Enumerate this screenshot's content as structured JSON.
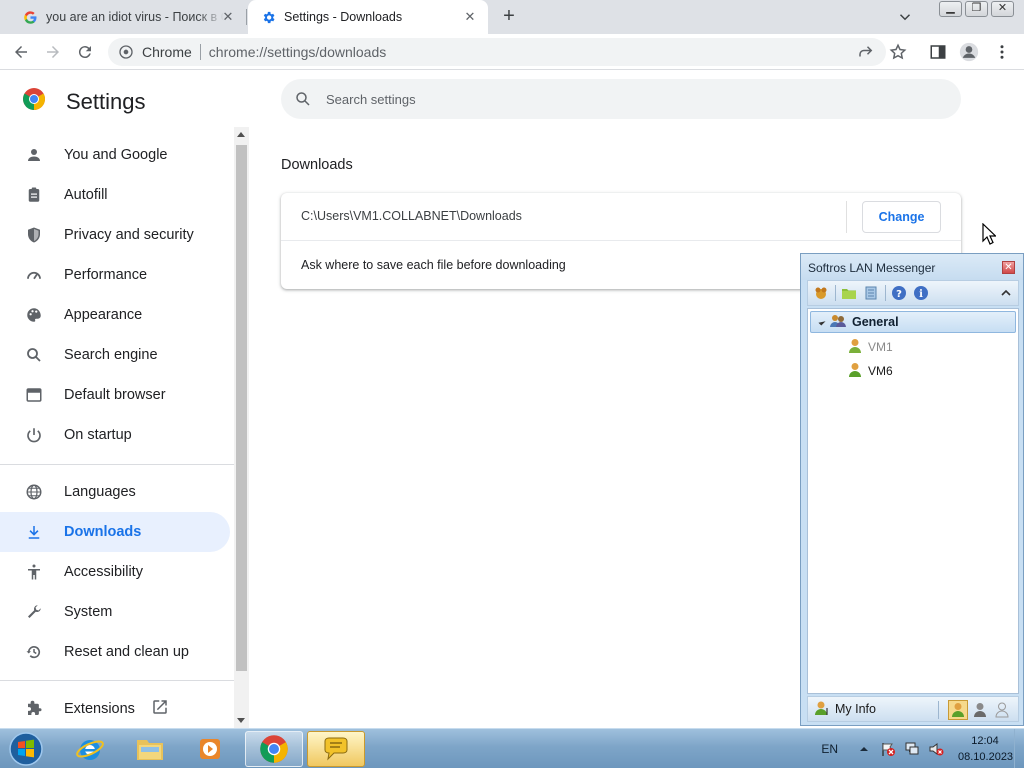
{
  "browser": {
    "tabs": [
      {
        "title": "you are an idiot virus - Поиск в Google",
        "icon": "google-g-icon"
      },
      {
        "title": "Settings - Downloads",
        "icon": "gear-icon"
      }
    ],
    "omnibox": {
      "chip": "Chrome",
      "url": "chrome://settings/downloads"
    }
  },
  "settings": {
    "brand": "Settings",
    "search_placeholder": "Search settings",
    "nav": [
      {
        "label": "You and Google",
        "icon": "person-icon"
      },
      {
        "label": "Autofill",
        "icon": "clipboard-icon"
      },
      {
        "label": "Privacy and security",
        "icon": "shield-icon"
      },
      {
        "label": "Performance",
        "icon": "speedometer-icon"
      },
      {
        "label": "Appearance",
        "icon": "palette-icon"
      },
      {
        "label": "Search engine",
        "icon": "search-icon"
      },
      {
        "label": "Default browser",
        "icon": "browser-window-icon"
      },
      {
        "label": "On startup",
        "icon": "power-icon"
      },
      {
        "label": "Languages",
        "icon": "globe-icon"
      },
      {
        "label": "Downloads",
        "icon": "download-icon",
        "active": true
      },
      {
        "label": "Accessibility",
        "icon": "accessibility-icon"
      },
      {
        "label": "System",
        "icon": "wrench-icon"
      },
      {
        "label": "Reset and clean up",
        "icon": "history-icon"
      },
      {
        "label": "Extensions",
        "icon": "puzzle-icon"
      }
    ],
    "section_title": "Downloads",
    "location_path": "C:\\Users\\VM1.COLLABNET\\Downloads",
    "change_label": "Change",
    "ask_label": "Ask where to save each file before downloading"
  },
  "lan_messenger": {
    "title": "Softros LAN Messenger",
    "group": "General",
    "users": [
      {
        "name": "VM1",
        "online": false
      },
      {
        "name": "VM6",
        "online": true
      }
    ],
    "my_info": "My Info"
  },
  "taskbar": {
    "language": "EN",
    "time": "12:04",
    "date": "08.10.2023"
  },
  "colors": {
    "accent": "#1a73e8",
    "active_nav_bg": "#e8f0fe",
    "taskbar": "#7ea5c8"
  }
}
